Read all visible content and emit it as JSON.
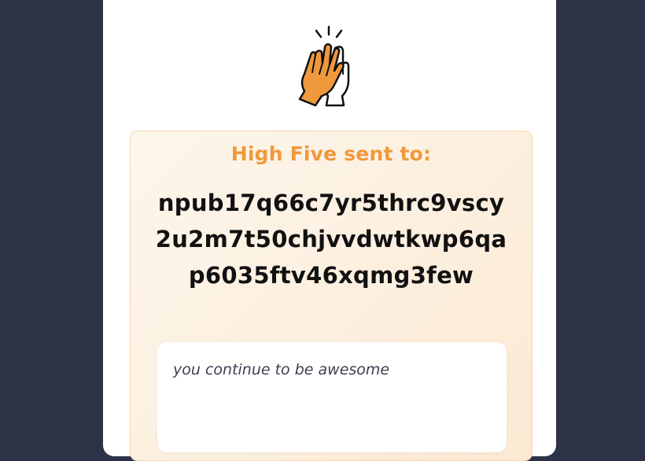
{
  "card": {
    "icon": "high-five-hands-icon",
    "heading": "High Five sent to:",
    "recipient_npub": "npub17q66c7yr5thrc9vscy2u2m7t50chjvvdwtkwp6qap6035ftv46xqmg3few",
    "message": "you continue to be awesome"
  },
  "colors": {
    "background": "#2d3246",
    "accent": "#f0993c",
    "panel": "#fbe9d3"
  }
}
